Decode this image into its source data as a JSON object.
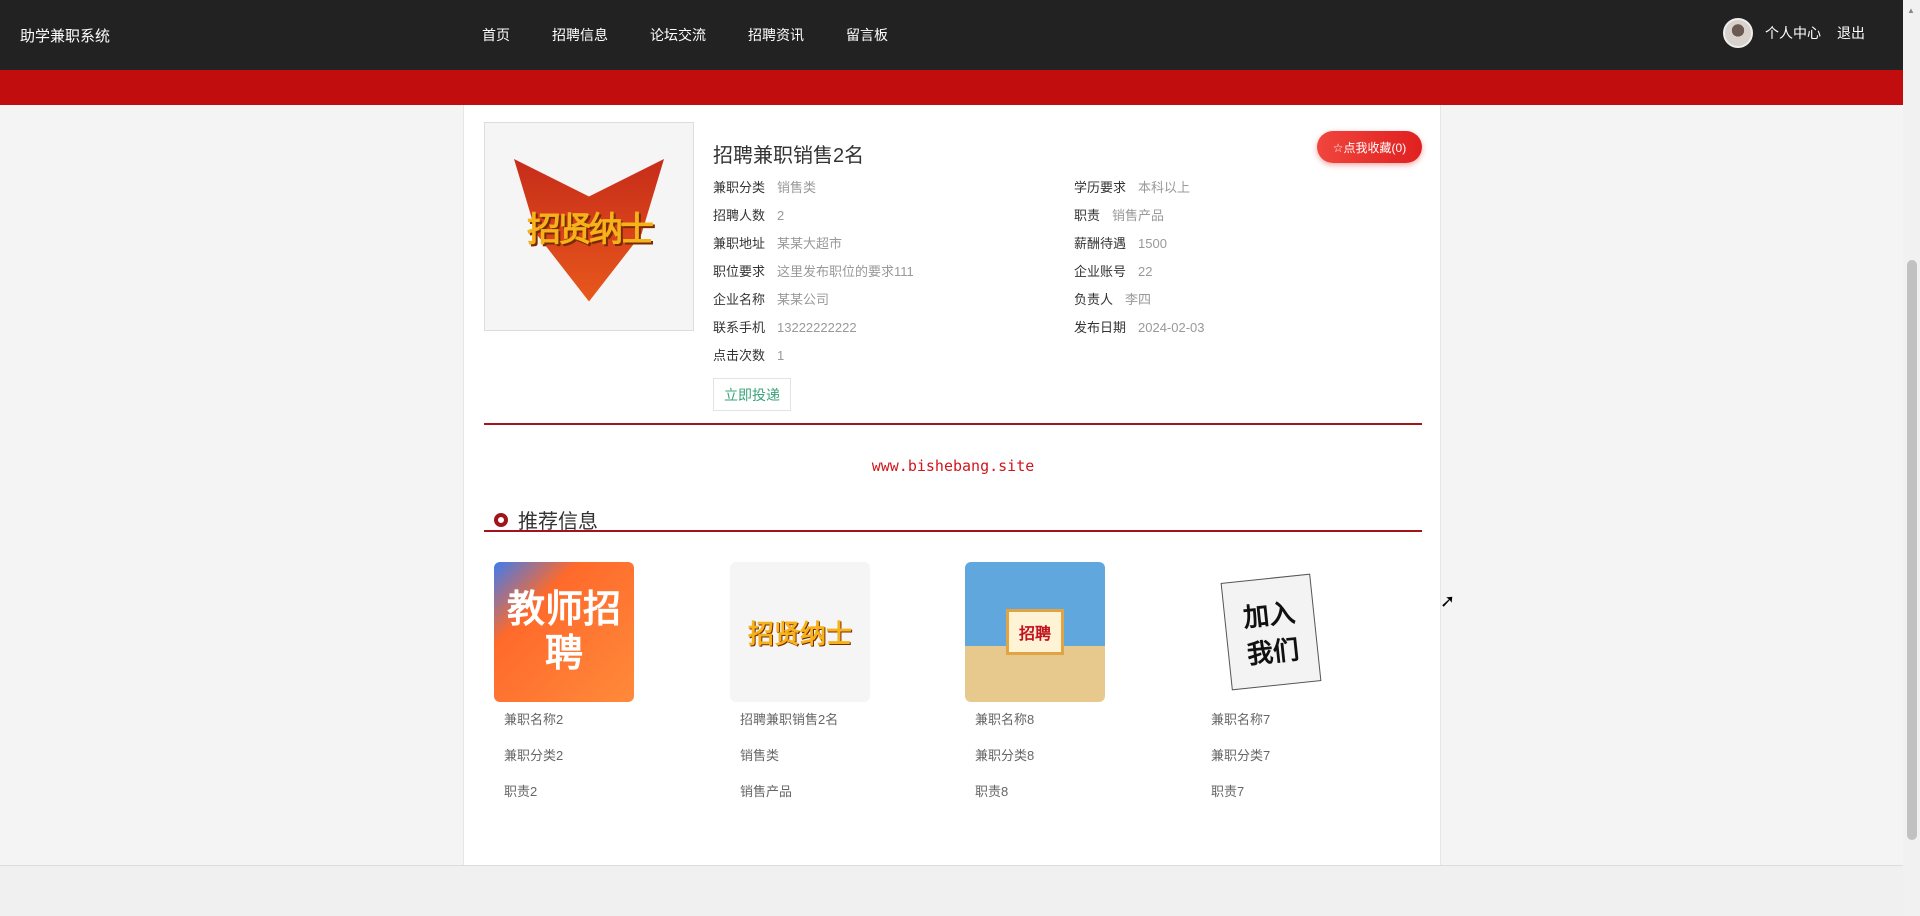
{
  "header": {
    "brand": "助学兼职系统",
    "nav": [
      "首页",
      "招聘信息",
      "论坛交流",
      "招聘资讯",
      "留言板"
    ],
    "user_center": "个人中心",
    "logout": "退出"
  },
  "detail": {
    "title": "招聘兼职销售2名",
    "image_text": "招贤纳士",
    "collect_label": "☆点我收藏(0)",
    "apply_label": "立即投递",
    "left": [
      {
        "label": "兼职分类",
        "value": "销售类"
      },
      {
        "label": "招聘人数",
        "value": "2"
      },
      {
        "label": "兼职地址",
        "value": "某某大超市"
      },
      {
        "label": "职位要求",
        "value": "这里发布职位的要求111"
      },
      {
        "label": "企业名称",
        "value": "某某公司"
      },
      {
        "label": "联系手机",
        "value": "13222222222"
      },
      {
        "label": "点击次数",
        "value": "1"
      }
    ],
    "right": [
      {
        "label": "学历要求",
        "value": "本科以上"
      },
      {
        "label": "职责",
        "value": "销售产品"
      },
      {
        "label": "薪酬待遇",
        "value": "1500"
      },
      {
        "label": "企业账号",
        "value": "22"
      },
      {
        "label": "负责人",
        "value": "李四"
      },
      {
        "label": "发布日期",
        "value": "2024-02-03"
      }
    ]
  },
  "watermark": "www.bishebang.site",
  "recommend": {
    "title": "推荐信息",
    "items": [
      {
        "image_text": "教师招聘",
        "name": "兼职名称2",
        "category": "兼职分类2",
        "duty": "职责2"
      },
      {
        "image_text": "招贤纳士",
        "name": "招聘兼职销售2名",
        "category": "销售类",
        "duty": "销售产品"
      },
      {
        "image_text": "招聘",
        "name": "兼职名称8",
        "category": "兼职分类8",
        "duty": "职责8"
      },
      {
        "image_text": "加入我们",
        "name": "兼职名称7",
        "category": "兼职分类7",
        "duty": "职责7"
      }
    ]
  },
  "colors": {
    "header": "#222222",
    "accent": "#c10d0d",
    "line": "#a0141a"
  }
}
